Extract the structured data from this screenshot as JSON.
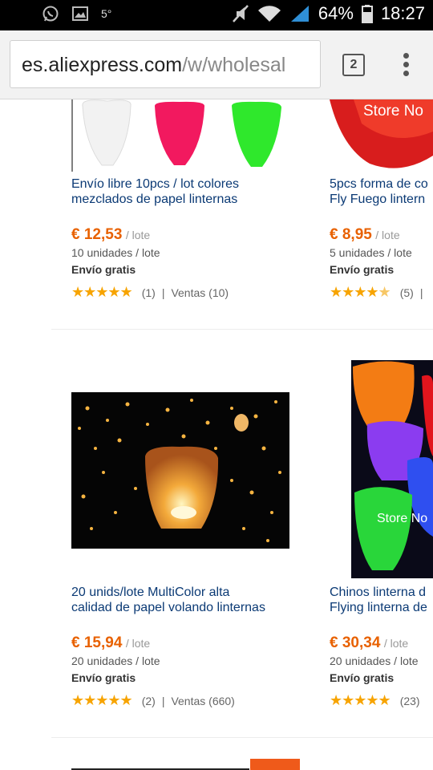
{
  "status_bar": {
    "temperature": "5°",
    "battery": "64%",
    "time": "18:27"
  },
  "browser": {
    "url_host": "es.aliexpress.com",
    "url_path": "/w/wholesal",
    "tab_count": "2"
  },
  "products": [
    {
      "title_line1": "Envío libre 10pcs / lot colores",
      "title_line2": "mezclados de papel linternas",
      "price": "€ 12,53",
      "price_unit": "/ lote",
      "lot": "10 unidades / lote",
      "shipping": "Envío gratis",
      "rating_stars": 5,
      "reviews": "(1)",
      "sales": "Ventas (10)",
      "separator": "|"
    },
    {
      "title_line1": "5pcs forma de co",
      "title_line2": "Fly Fuego lintern",
      "price": "€ 8,95",
      "price_unit": "/ lote",
      "lot": "5 unidades / lote",
      "shipping": "Envío gratis",
      "rating_stars": 4.5,
      "reviews": "(5)",
      "sales": "",
      "separator": "|"
    },
    {
      "title_line1": "20 unids/lote MultiColor alta",
      "title_line2": "calidad de papel volando linternas",
      "price": "€ 15,94",
      "price_unit": "/ lote",
      "lot": "20 unidades / lote",
      "shipping": "Envío gratis",
      "rating_stars": 5,
      "reviews": "(2)",
      "sales": "Ventas (660)",
      "separator": "|"
    },
    {
      "title_line1": "Chinos linterna d",
      "title_line2": "Flying linterna de",
      "price": "€ 30,34",
      "price_unit": "/ lote",
      "lot": "20 unidades / lote",
      "shipping": "Envío gratis",
      "rating_stars": 5,
      "reviews": "(23)",
      "sales": "",
      "separator": ""
    }
  ],
  "image_watermark": "Store No",
  "colors": {
    "price": "#e86100",
    "title_link": "#0b3a75",
    "star": "#f7a400"
  }
}
